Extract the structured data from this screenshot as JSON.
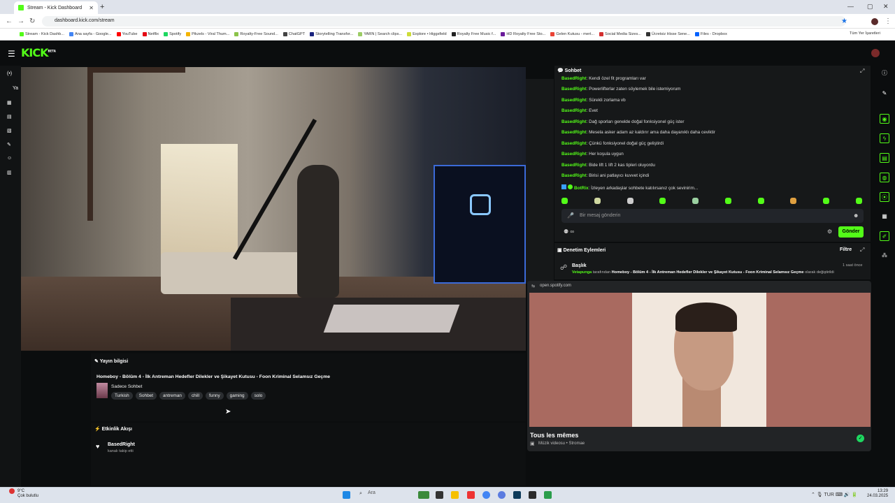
{
  "browser": {
    "tab_title": "Stream - Kick Dashboard",
    "url": "dashboard.kick.com/stream",
    "bookmarks": [
      "Stream - Kick Dashb...",
      "Ana sayfa - Google...",
      "YouTube",
      "Netflix",
      "Spotify",
      "Pikzels - Viral Thum...",
      "Royalty-Free Sound...",
      "ChatGPT",
      "Storytelling Transfor...",
      "YARN | Search clips...",
      "Explore • Higgsfield",
      "Royalty Free Music f...",
      "HD Royalty Free Sto...",
      "Gelen Kutusu - mert...",
      "Social Media Sizes...",
      "Ücretsiz Hisse Sene...",
      "Files - Dropbox"
    ],
    "all_bookmarks": "Tüm Yer İşaretleri"
  },
  "logo": "KICK",
  "logo_badge": "BETA",
  "chat": {
    "title": "Sohbet",
    "messages": [
      {
        "user": "BasedRight",
        "text": "Kendi özel fit programları var"
      },
      {
        "user": "BasedRight",
        "text": "Powerlifterlar zaten söylemek bile istemiyorum"
      },
      {
        "user": "BasedRight",
        "text": "Sürekli zorlama vb"
      },
      {
        "user": "BasedRight",
        "text": "Evet"
      },
      {
        "user": "BasedRight",
        "text": "Dağ sporları genelde doğal fonksiyonel güç ister"
      },
      {
        "user": "BasedRight",
        "text": "Mesela asker adam az kaldırır ama daha dayanıklı daha ceviktir"
      },
      {
        "user": "BasedRight",
        "text": "Çünkü fonksiyonel doğal güç geliştirdi"
      },
      {
        "user": "BasedRight",
        "text": "Her koşula uygun"
      },
      {
        "user": "BasedRight",
        "text": "Bide lift 1 lift 2 kas tipleri oluyordu"
      },
      {
        "user": "BasedRight",
        "text": "Birisi ani patlayıcı kuvvet içindi"
      },
      {
        "user": "BotRix",
        "text": "İzleyen arkadaşlar sohbete katılırsanız çok sevinirim..."
      }
    ],
    "input_placeholder": "Bir mesaj gönderin",
    "send_label": "Gönder"
  },
  "moderation": {
    "title": "Denetim Eylemleri",
    "filter": "Filtre",
    "item_title": "Başlık",
    "item_time": "1 saat önce",
    "actor": "Vetapunga",
    "by": "tarafından",
    "new_title": "Homeboy - Bölüm 4 - İlk Antreman Hedefler Dilekler ve Şikayet Kutusu - Foon Kriminal Selamsız Geçme",
    "action": "olarak değiştirildi"
  },
  "spotify": {
    "host": "open.spotify.com",
    "track": "Tous les mêmes",
    "subtitle": "Müzik videosu • Stromae"
  },
  "stream_info": {
    "header": "Yayın bilgisi",
    "title": "Homeboy - Bölüm 4 - İlk Antreman Hedefler Dilekler ve Şikayet Kutusu - Foon Kriminal Selamsız Geçme",
    "category": "Sadece Sohbet",
    "tags": [
      "Turkish",
      "Sohbet",
      "antreman",
      "chill",
      "funny",
      "gaming",
      "solo"
    ]
  },
  "activity": {
    "header": "Etkinlik Akışı",
    "user": "BasedRight",
    "desc": "kanalı takip etti"
  },
  "taskbar": {
    "temp": "9°C",
    "weather": "Çok bulutlu",
    "search": "Ara",
    "lang": "TUR",
    "time": "13:29",
    "date": "24.03.2025"
  },
  "colors": {
    "accent": "#53fc18",
    "bg": "#0b0d0e",
    "panel": "#161819"
  }
}
